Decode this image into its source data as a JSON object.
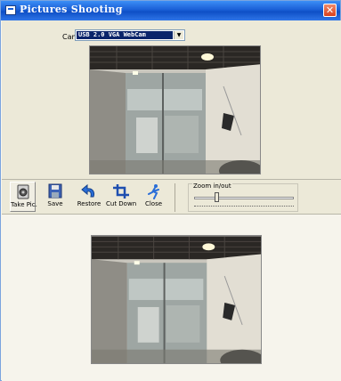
{
  "window": {
    "title": "Pictures Shooting",
    "close_glyph": "✕"
  },
  "camera": {
    "label": "Camera",
    "selected": "USB 2.0 VGA WebCam"
  },
  "toolbar": {
    "buttons": [
      {
        "label": "Take Pic.",
        "icon": "camera-icon"
      },
      {
        "label": "Save",
        "icon": "floppy-disk-icon"
      },
      {
        "label": "Restore",
        "icon": "undo-arrow-icon"
      },
      {
        "label": "Cut Down",
        "icon": "crop-icon"
      },
      {
        "label": "Close",
        "icon": "running-man-icon"
      }
    ]
  },
  "zoom": {
    "label": "Zoom in/out",
    "level": 0.22
  },
  "colors": {
    "titlebar": "#0e4fc6",
    "selection": "#0a246a",
    "window_bg": "#ece9d8"
  }
}
